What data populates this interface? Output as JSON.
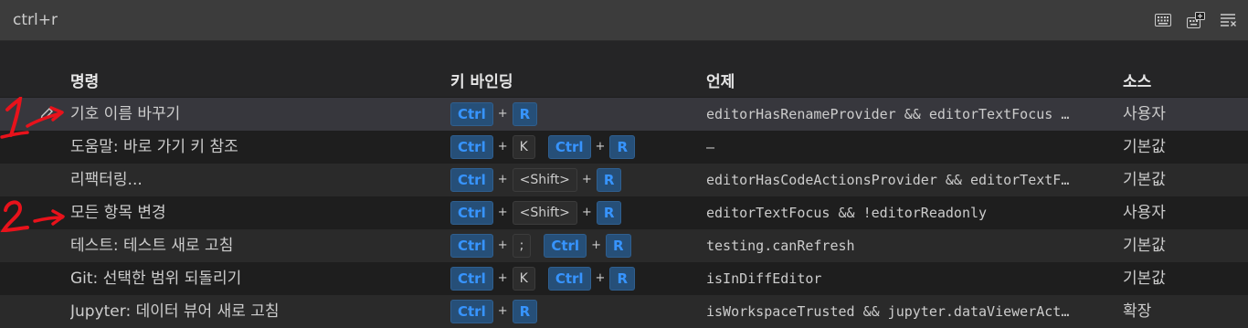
{
  "search": {
    "value": "ctrl+r"
  },
  "toolbar": {
    "icons": [
      "keyboard-icon",
      "record-keys-icon",
      "clear-filter-icon"
    ]
  },
  "columns": {
    "command": "명령",
    "keybinding": "키 바인딩",
    "when": "언제",
    "source": "소스"
  },
  "rows": [
    {
      "command": "기호 이름 바꾸기",
      "keys": [
        [
          "Ctrl",
          "R"
        ]
      ],
      "when": "editorHasRenameProvider && editorTextFocus …",
      "source": "사용자"
    },
    {
      "command": "도움말: 바로 가기 키 참조",
      "keys": [
        [
          "Ctrl",
          "K"
        ],
        [
          "Ctrl",
          "R"
        ]
      ],
      "when": "–",
      "source": "기본값"
    },
    {
      "command": "리팩터링...",
      "keys": [
        [
          "Ctrl",
          "<Shift>",
          "R"
        ]
      ],
      "when": "editorHasCodeActionsProvider && editorTextF…",
      "source": "기본값"
    },
    {
      "command": "모든 항목 변경",
      "keys": [
        [
          "Ctrl",
          "<Shift>",
          "R"
        ]
      ],
      "when": "editorTextFocus && !editorReadonly",
      "source": "사용자"
    },
    {
      "command": "테스트: 테스트 새로 고침",
      "keys": [
        [
          "Ctrl",
          ";"
        ],
        [
          "Ctrl",
          "R"
        ]
      ],
      "when": "testing.canRefresh",
      "source": "기본값"
    },
    {
      "command": "Git: 선택한 범위 되돌리기",
      "keys": [
        [
          "Ctrl",
          "K"
        ],
        [
          "Ctrl",
          "R"
        ]
      ],
      "when": "isInDiffEditor",
      "source": "기본값"
    },
    {
      "command": "Jupyter: 데이터 뷰어 새로 고침",
      "keys": [
        [
          "Ctrl",
          "R"
        ]
      ],
      "when": "isWorkspaceTrusted && jupyter.dataViewerAct…",
      "source": "확장"
    }
  ],
  "annotations": [
    {
      "label": "1",
      "color": "#e8121b"
    },
    {
      "label": "2",
      "color": "#e8121b"
    }
  ],
  "colors": {
    "background": "#1e1e1e",
    "key_highlight_bg": "#264f78",
    "key_highlight_text": "#3794ff",
    "selected_row": "#37373d"
  }
}
